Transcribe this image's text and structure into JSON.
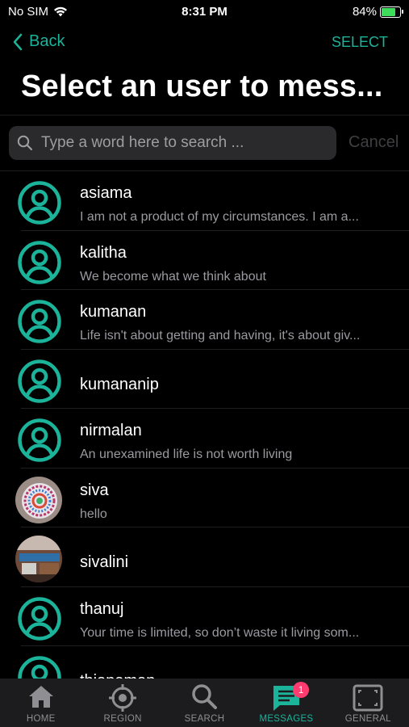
{
  "status_bar": {
    "carrier": "No SIM",
    "time": "8:31 PM",
    "battery": "84%",
    "battery_level": 0.84
  },
  "nav": {
    "back_label": "Back",
    "select_label": "SELECT"
  },
  "title": "Select an user to mess...",
  "search": {
    "placeholder": "Type a word here to search ...",
    "value": "",
    "cancel_label": "Cancel"
  },
  "users": [
    {
      "name": "asiama",
      "message": "I am not a product of my circumstances. I am a...",
      "avatar": "default-avatar-icon"
    },
    {
      "name": "kalitha",
      "message": "We become what we think about",
      "avatar": "default-avatar-icon"
    },
    {
      "name": "kumanan",
      "message": "Life isn't about getting and having, it's about giv...",
      "avatar": "default-avatar-icon"
    },
    {
      "name": "kumananip",
      "message": "",
      "avatar": "default-avatar-icon"
    },
    {
      "name": "nirmalan",
      "message": "An unexamined life is not worth living",
      "avatar": "default-avatar-icon"
    },
    {
      "name": "siva",
      "message": "hello",
      "avatar": "photo-mandala"
    },
    {
      "name": "sivalini",
      "message": "",
      "avatar": "photo-room"
    },
    {
      "name": "thanuj",
      "message": "Your time is limited, so don’t waste it living som...",
      "avatar": "default-avatar-icon"
    },
    {
      "name": "thianaman",
      "message": "",
      "avatar": "default-avatar-icon"
    }
  ],
  "tabs": [
    {
      "label": "HOME",
      "icon": "home-icon",
      "active": false
    },
    {
      "label": "REGION",
      "icon": "target-icon",
      "active": false
    },
    {
      "label": "SEARCH",
      "icon": "search-icon",
      "active": false
    },
    {
      "label": "MESSAGES",
      "icon": "messages-icon",
      "active": true,
      "badge": "1"
    },
    {
      "label": "GENERAL",
      "icon": "general-icon",
      "active": false
    }
  ],
  "colors": {
    "accent": "#1bb39a",
    "badge": "#ff3b6f",
    "background": "#000000"
  }
}
